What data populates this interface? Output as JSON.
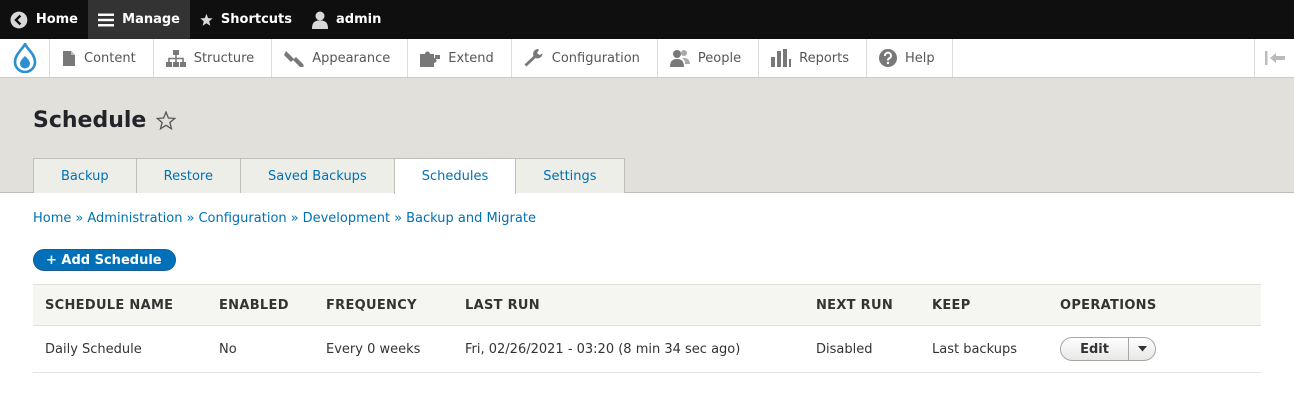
{
  "toolbar": {
    "home": "Home",
    "manage": "Manage",
    "shortcuts": "Shortcuts",
    "user": "admin"
  },
  "tray": {
    "items": [
      {
        "label": "Content",
        "icon": "file-icon"
      },
      {
        "label": "Structure",
        "icon": "structure-icon"
      },
      {
        "label": "Appearance",
        "icon": "paintbrush-icon"
      },
      {
        "label": "Extend",
        "icon": "puzzle-icon"
      },
      {
        "label": "Configuration",
        "icon": "wrench-icon"
      },
      {
        "label": "People",
        "icon": "people-icon"
      },
      {
        "label": "Reports",
        "icon": "bar-chart-icon"
      },
      {
        "label": "Help",
        "icon": "help-icon"
      }
    ]
  },
  "page": {
    "title": "Schedule",
    "tabs": [
      {
        "label": "Backup",
        "active": false
      },
      {
        "label": "Restore",
        "active": false
      },
      {
        "label": "Saved Backups",
        "active": false
      },
      {
        "label": "Schedules",
        "active": true
      },
      {
        "label": "Settings",
        "active": false
      }
    ],
    "breadcrumb": [
      "Home",
      "Administration",
      "Configuration",
      "Development",
      "Backup and Migrate"
    ],
    "breadcrumb_sep": "»",
    "add_button": "+ Add Schedule"
  },
  "table": {
    "headers": [
      "Schedule name",
      "Enabled",
      "Frequency",
      "Last run",
      "Next run",
      "Keep",
      "Operations"
    ],
    "rows": [
      {
        "name": "Daily Schedule",
        "enabled": "No",
        "frequency": "Every 0 weeks",
        "last_run": "Fri, 02/26/2021 - 03:20 (8 min 34 sec ago)",
        "next_run": "Disabled",
        "keep": "Last backups",
        "operation": "Edit"
      }
    ]
  },
  "colors": {
    "toolbar_bg": "#0f0f0f",
    "link": "#0071b3",
    "primary_button": "#0071b8",
    "header_bg": "#e1e0da"
  }
}
